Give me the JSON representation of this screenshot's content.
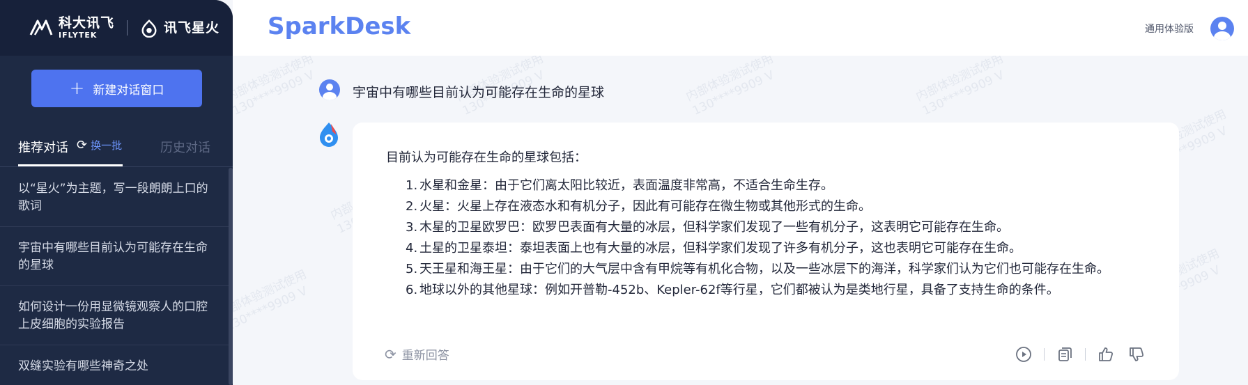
{
  "sidebar": {
    "logo_iflytek_cn": "科大讯飞",
    "logo_iflytek_en": "IFLYTEK",
    "logo_spark_cn": "讯飞星火",
    "new_chat_label": "新建对话窗口",
    "tab_recommended": "推荐对话",
    "refresh_label": "换一批",
    "tab_history": "历史对话",
    "items": [
      {
        "label": "以“星火”为主题，写一段朗朗上口的歌词"
      },
      {
        "label": "宇宙中有哪些目前认为可能存在生命的星球"
      },
      {
        "label": "如何设计一份用显微镜观察人的口腔上皮细胞的实验报告"
      },
      {
        "label": "双缝实验有哪些神奇之处"
      }
    ]
  },
  "header": {
    "brand": "SparkDesk",
    "edition": "通用体验版"
  },
  "chat": {
    "question": "宇宙中有哪些目前认为可能存在生命的星球",
    "answer_intro": "目前认为可能存在生命的星球包括：",
    "answer_items": [
      {
        "num": "1.",
        "text": "水星和金星：由于它们离太阳比较近，表面温度非常高，不适合生命生存。"
      },
      {
        "num": "2.",
        "text": "火星：火星上存在液态水和有机分子，因此有可能存在微生物或其他形式的生命。"
      },
      {
        "num": "3.",
        "text": "木星的卫星欧罗巴：欧罗巴表面有大量的冰层，但科学家们发现了一些有机分子，这表明它可能存在生命。"
      },
      {
        "num": "4.",
        "text": "土星的卫星泰坦：泰坦表面上也有大量的冰层，但科学家们发现了许多有机分子，这也表明它可能存在生命。"
      },
      {
        "num": "5.",
        "text": "天王星和海王星：由于它们的大气层中含有甲烷等有机化合物，以及一些冰层下的海洋，科学家们认为它们也可能存在生命。"
      },
      {
        "num": "6.",
        "text": "地球以外的其他星球：例如开普勒-452b、Kepler-62f等行星，它们都被认为是类地行星，具备了支持生命的条件。"
      }
    ],
    "regenerate_label": "重新回答"
  },
  "watermark_text": "内部体验测试使用\n130****9909 V",
  "colors": {
    "sidebar_bg": "#1e2a44",
    "accent": "#4e73ef",
    "brand": "#5b82f0"
  },
  "icons": [
    "plus-icon",
    "refresh-icon",
    "user-avatar-icon",
    "spark-assistant-icon",
    "regenerate-icon",
    "play-icon",
    "copy-icon",
    "thumbs-up-icon",
    "thumbs-down-icon"
  ]
}
